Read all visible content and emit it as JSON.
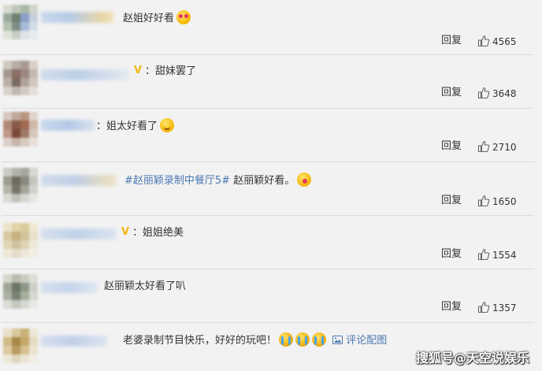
{
  "comments": [
    {
      "text": "赵姐好好看",
      "emojis": [
        "heart-eyes-emoji"
      ],
      "reply_label": "回复",
      "likes": "4565"
    },
    {
      "text": "：甜妹罢了",
      "verified": "V",
      "reply_label": "回复",
      "likes": "3648"
    },
    {
      "text": "：姐太好看了",
      "emojis": [
        "smile-emoji"
      ],
      "reply_label": "回复",
      "likes": "2710"
    },
    {
      "hashtag": "#赵丽颖录制中餐厅5#",
      "text": " 赵丽颖好看。",
      "emojis": [
        "kiss-emoji"
      ],
      "reply_label": "回复",
      "likes": "1650"
    },
    {
      "text": "：姐姐绝美",
      "verified": "V",
      "reply_label": "回复",
      "likes": "1554"
    },
    {
      "text": "赵丽颖太好看了叭",
      "reply_label": "回复",
      "likes": "1357"
    },
    {
      "text": "老婆录制节目快乐，好好的玩吧！",
      "emojis": [
        "crying-emoji",
        "crying-emoji",
        "crying-emoji"
      ],
      "link": "评论配图"
    }
  ],
  "watermark": "搜狐号@天空说娱乐",
  "colors": {
    "background": "#f2f2f2",
    "link": "#4a78b3",
    "verified_badge": "#f1b611",
    "divider": "#dcdcdc"
  }
}
